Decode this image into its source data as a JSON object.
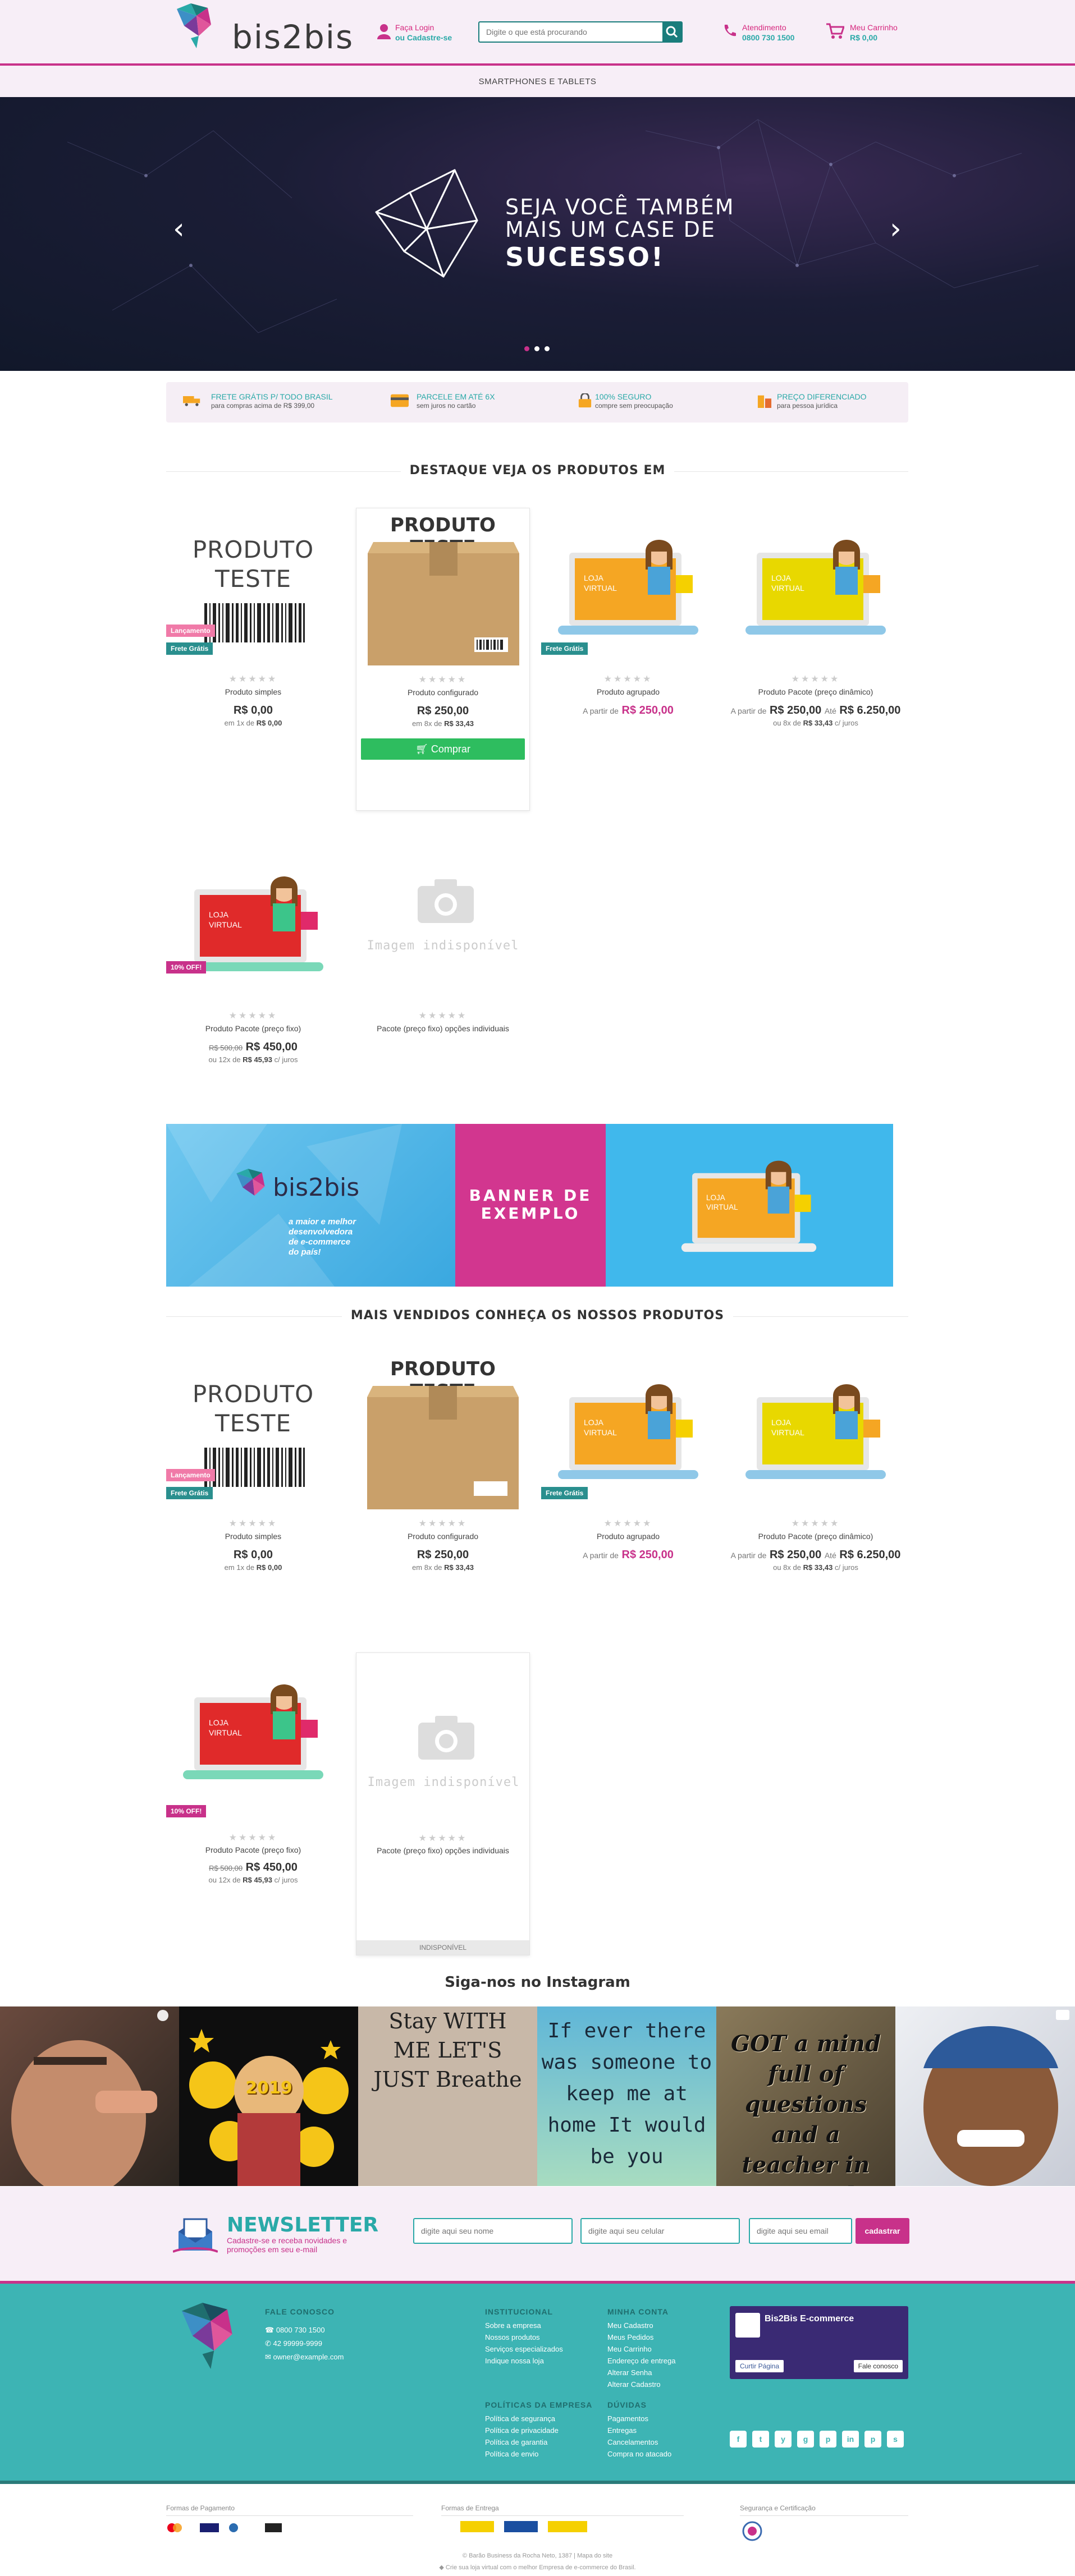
{
  "header": {
    "brand": "bis2bis",
    "login_line1": "Faça Login",
    "login_line2": "ou Cadastre-se",
    "search_placeholder": "Digite o que está procurando",
    "support_label": "Atendimento",
    "support_phone": "0800 730 1500",
    "cart_label": "Meu Carrinho",
    "cart_total": "R$ 0,00"
  },
  "nav": {
    "item": "SMARTPHONES E TABLETS"
  },
  "hero": {
    "line1": "SEJA VOCÊ TAMBÉM",
    "line2": "MAIS UM CASE DE",
    "line3": "SUCESSO!",
    "slides": 3,
    "active_slide": 1
  },
  "benefits": [
    {
      "title": "FRETE GRÁTIS P/ TODO BRASIL",
      "sub": "para compras acima de R$ 399,00"
    },
    {
      "title": "PARCELE EM ATÉ 6X",
      "sub": "sem juros no cartão"
    },
    {
      "title": "100% SEGURO",
      "sub": "compre sem preocupação"
    },
    {
      "title": "PREÇO DIFERENCIADO",
      "sub": "para pessoa jurídica"
    }
  ],
  "section1": {
    "title": "DESTAQUE VEJA OS PRODUTOS EM"
  },
  "section2": {
    "title": "MAIS VENDIDOS CONHEÇA OS NOSSOS PRODUTOS"
  },
  "labels": {
    "stars": "★★★★★",
    "buy": "Comprar",
    "unavailable": "INDISPONÍVEL",
    "no_image": "Imagem indisponível",
    "frete": "Frete Grátis",
    "lancamento": "Lançamento",
    "off": "10% OFF!",
    "produto_teste_a": "PRODUTO",
    "produto_teste_b": "TESTE",
    "produto_teste_box": "PRODUTO TESTE",
    "loja": "LOJA",
    "virtual": "VIRTUAL",
    "a_partir": "A partir de",
    "ate": "Até"
  },
  "products": [
    {
      "name": "Produto simples",
      "price": "R$ 0,00",
      "sub_prefix": "em 1x de",
      "sub_value": "R$ 0,00",
      "sub_suffix": ""
    },
    {
      "name": "Produto configurado",
      "price": "R$ 250,00",
      "sub_prefix": "em 8x de",
      "sub_value": "R$ 33,43",
      "sub_suffix": ""
    },
    {
      "name": "Produto agrupado",
      "price": "R$ 250,00"
    },
    {
      "name": "Produto Pacote (preço dinâmico)",
      "price": "R$ 250,00",
      "price2": "R$ 6.250,00",
      "sub_prefix": "ou 8x de",
      "sub_value": "R$ 33,43",
      "sub_suffix": "c/ juros"
    },
    {
      "name": "Produto Pacote (preço fixo)",
      "old": "R$ 500,00",
      "price": "R$ 450,00",
      "sub_prefix": "ou 12x de",
      "sub_value": "R$ 45,93",
      "sub_suffix": "c/ juros"
    },
    {
      "name": "Pacote (preço fixo) opções individuais"
    }
  ],
  "banner": {
    "brand": "bis2bis",
    "tagline1": "a maior e melhor",
    "tagline2": "desenvolvedora",
    "tagline3": "de e-commerce",
    "tagline4": "do país!",
    "center1": "BANNER DE",
    "center2": "EXEMPLO"
  },
  "instagram": {
    "title": "Siga-nos no Instagram",
    "posts": [
      {
        "text": ""
      },
      {
        "text": "2019"
      },
      {
        "text": "Stay WITH ME LET'S JUST Breathe"
      },
      {
        "text": "If ever there was someone to keep me at home It would be you"
      },
      {
        "text": "GOT a mind full of questions and a teacher in my soul"
      },
      {
        "text": ""
      }
    ]
  },
  "newsletter": {
    "title": "NEWSLETTER",
    "desc": "Cadastre-se e receba novidades e promoções em seu e-mail",
    "name_ph": "digite aqui seu nome",
    "phone_ph": "digite aqui seu celular",
    "email_ph": "digite aqui seu email",
    "submit": "cadastrar"
  },
  "footer": {
    "contact_title": "FALE CONOSCO",
    "phone1": "0800 730 1500",
    "phone2": "42 99999-9999",
    "email": "owner@example.com",
    "inst_title": "INSTITUCIONAL",
    "inst": [
      "Sobre a empresa",
      "Nossos produtos",
      "Serviços especializados",
      "Indique nossa loja"
    ],
    "account_title": "MINHA CONTA",
    "account": [
      "Meu Cadastro",
      "Meus Pedidos",
      "Meu Carrinho",
      "Endereço de entrega",
      "Alterar Senha",
      "Alterar Cadastro"
    ],
    "policies_title": "POLÍTICAS DA EMPRESA",
    "policies": [
      "Política de segurança",
      "Política de privacidade",
      "Política de garantia",
      "Política de envio"
    ],
    "doubts_title": "DÚVIDAS",
    "doubts": [
      "Pagamentos",
      "Entregas",
      "Cancelamentos",
      "Compra no atacado"
    ],
    "fb_name": "Bis2Bis E-commerce",
    "fb_like": "Curtir Página",
    "fb_contact": "Fale conosco",
    "social": [
      "f",
      "t",
      "y",
      "g",
      "p",
      "in",
      "p",
      "s"
    ]
  },
  "bottom": {
    "payments": "Formas de Pagamento",
    "shipping": "Formas de Entrega",
    "security": "Segurança e Certificação",
    "copyright": "© Barão Business da Rocha Neto, 1387 | Mapa do site",
    "powered": "Crie sua loja virtual com o melhor Empresa de e-commerce do Brasil."
  },
  "colors": {
    "pink": "#c8318a",
    "teal": "#2aa9a8",
    "green": "#2ebd5f"
  }
}
